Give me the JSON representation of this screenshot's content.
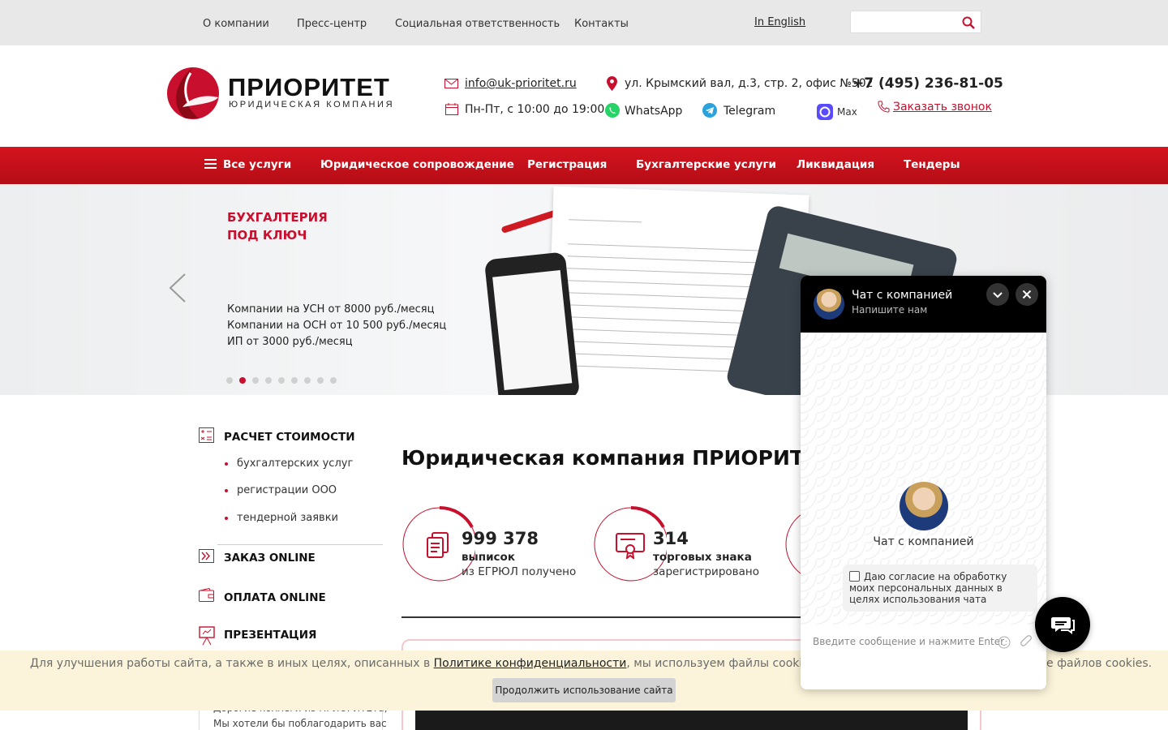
{
  "topnav": {
    "links": [
      "О компании",
      "Пресс-центр",
      "Социальная ответственность",
      "Контакты"
    ],
    "lang": "In English",
    "search_placeholder": ""
  },
  "header": {
    "logo_name": "ПРИОРИТЕТ",
    "logo_sub": "ЮРИДИЧЕСКАЯ КОМПАНИЯ",
    "email": "info@uk-prioritet.ru",
    "hours": "Пн-Пт, с 10:00 до 19:00",
    "address": "ул. Крымский вал, д.3, стр. 2, офис №502",
    "whatsapp": "WhatsApp",
    "telegram": "Telegram",
    "max": "Max",
    "phone": "+7 (495) 236-81-05",
    "callback": "Заказать звонок"
  },
  "mainnav": {
    "items": [
      "Все услуги",
      "Юридическое сопровождение",
      "Регистрация",
      "Бухгалтерские услуги",
      "Ликвидация",
      "Тендеры"
    ]
  },
  "slider": {
    "title_line1": "БУХГАЛТЕРИЯ",
    "title_line2": "ПОД КЛЮЧ",
    "lines": [
      "Компании на УСН от 8000 руб./месяц",
      "Компании на ОСН от 10 500 руб./месяц",
      "ИП от 3000 руб./месяц"
    ],
    "dot_count": 9,
    "active_dot": 2
  },
  "sidebar": {
    "calc_title": "РАСЧЕТ СТОИМОСТИ",
    "calc_items": [
      "бухгалтерских услуг",
      "регистрации ООО",
      "тендерной заявки"
    ],
    "order": "ЗАКАЗ ONLINE",
    "payment": "ОПЛАТА ONLINE",
    "presentation": "ПРЕЗЕНТАЦИЯ",
    "news_line1": "Дорогие коллеги из ПРИОРИТЕТа,",
    "news_line2": "Мы хотели бы поблагодарить вас"
  },
  "main": {
    "title": "Юридическая компания ПРИОРИТЕТ",
    "stats": [
      {
        "number": "999 378",
        "label1": "выписок",
        "label2": "из ЕГРЮЛ получено"
      },
      {
        "number": "314",
        "label1": "торговых знака",
        "label2": "зарегистрировано"
      }
    ]
  },
  "cookie": {
    "text_before": "Для улучшения работы сайта, а также в иных целях, описанных в ",
    "link": "Политике конфиденциальности",
    "text_after": ", мы используем файлы cookies. Проставляя",
    "text_tail": "е файлов cookies.",
    "button": "Продолжить использование сайта"
  },
  "chat": {
    "title": "Чат с компанией",
    "subtitle": "Напишите нам",
    "name": "Чат с компанией",
    "consent": "Даю согласие на обработку моих персональных данных в целях использования чата",
    "input_placeholder": "Введите сообщение и нажмите Enter"
  },
  "colors": {
    "brand_red": "#c8102e",
    "nav_red": "#c8101c",
    "chat_header": "#000000",
    "cookie_bg": "#fcf4da"
  }
}
